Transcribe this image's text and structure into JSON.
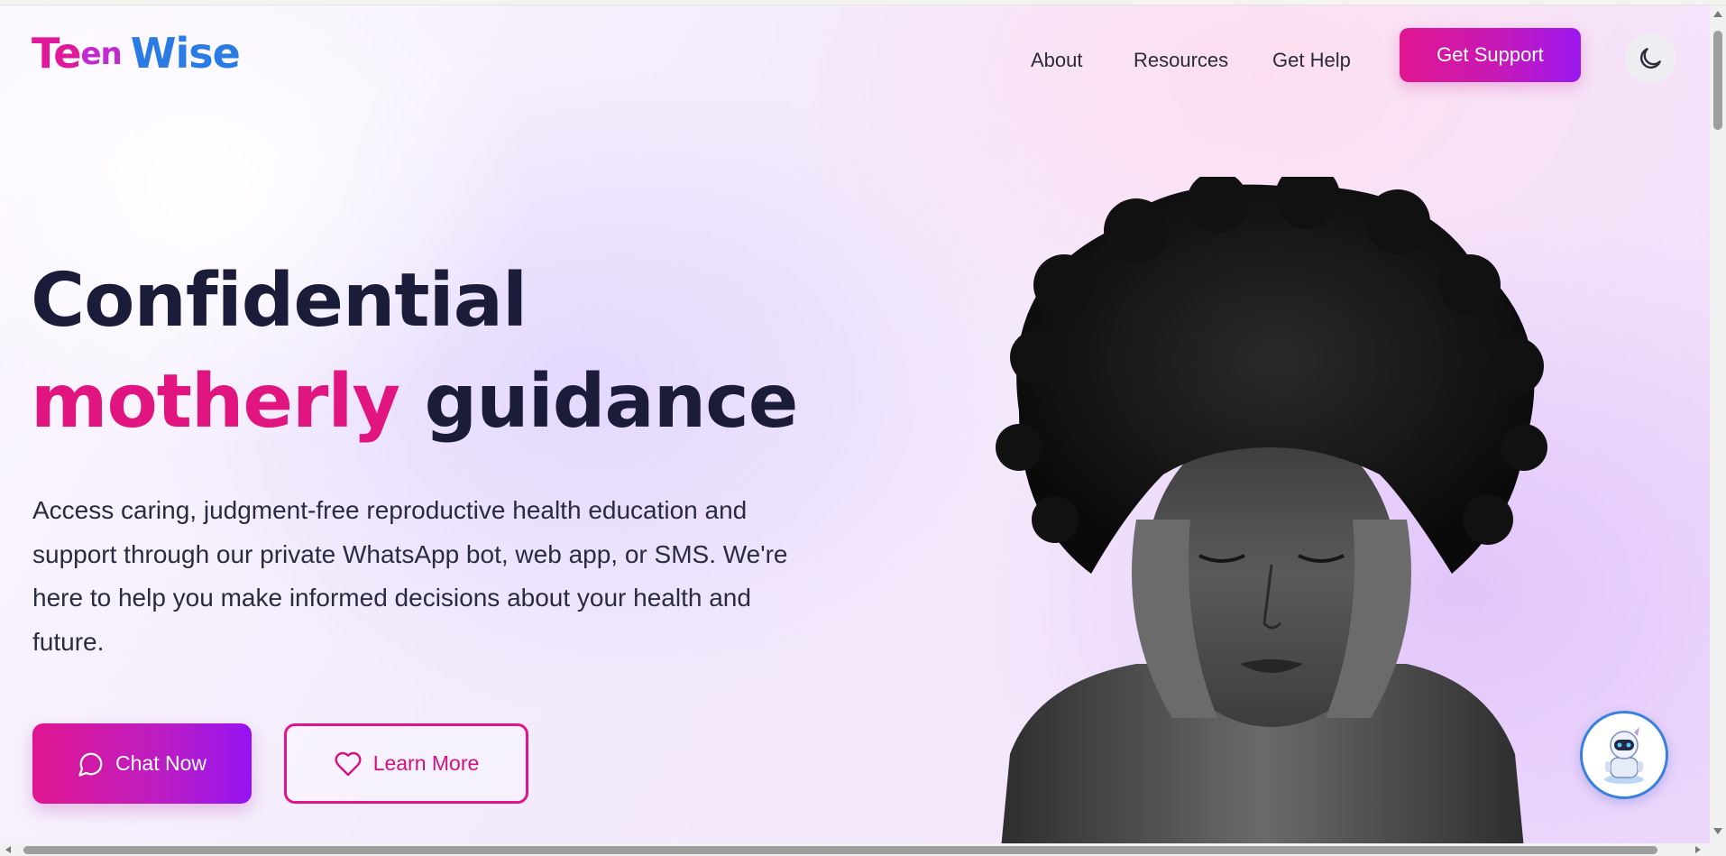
{
  "brand": {
    "logo_part1": "Te",
    "logo_part2": "en",
    "logo_part3": "Wise",
    "colors": {
      "pink": "#e0189a",
      "purple": "#c22ad0",
      "blue": "#2a7be4"
    }
  },
  "nav": {
    "links": [
      {
        "label": "About"
      },
      {
        "label": "Resources"
      },
      {
        "label": "Get Help"
      }
    ],
    "cta_label": "Get Support",
    "theme_toggle_icon": "moon-icon"
  },
  "hero": {
    "title_line1": "Confidential",
    "title_highlight": "motherly",
    "title_line2_rest": "guidance",
    "description": "Access caring, judgment-free reproductive health education and support through our private WhatsApp bot, web app, or SMS. We're here to help you make informed decisions about your health and future.",
    "primary_button": {
      "label": "Chat Now",
      "icon": "chat-bubble-icon"
    },
    "secondary_button": {
      "label": "Learn More",
      "icon": "heart-icon"
    },
    "accent_color": "#e01580",
    "heading_color": "#1b1b3a"
  },
  "chatbot": {
    "icon": "robot-avatar-icon",
    "border_color": "#3a7fe0"
  }
}
